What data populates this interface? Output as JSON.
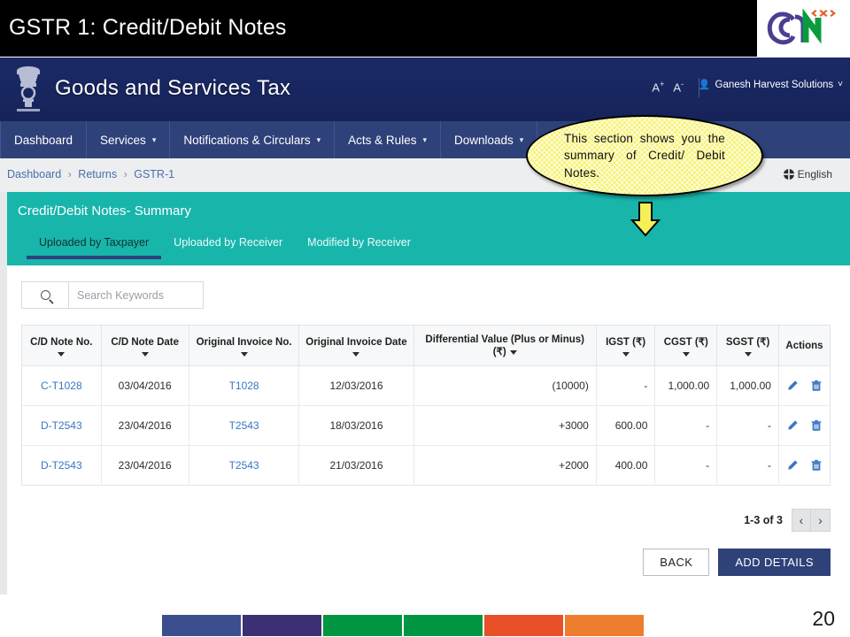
{
  "slide": {
    "title": "GSTR 1: Credit/Debit Notes",
    "number": "20",
    "logo_alt": "gstn-logo"
  },
  "portal_header": {
    "title": "Goods and Services Tax",
    "font_increase": "A",
    "font_increase_sup": "+",
    "font_decrease": "A",
    "font_decrease_sup": "-",
    "user_name": "Ganesh Harvest Solutions",
    "user_caret": "˅"
  },
  "nav": {
    "items": [
      {
        "label": "Dashboard",
        "has_caret": false
      },
      {
        "label": "Services",
        "has_caret": true
      },
      {
        "label": "Notifications & Circulars",
        "has_caret": true
      },
      {
        "label": "Acts & Rules",
        "has_caret": true
      },
      {
        "label": "Downloads",
        "has_caret": true
      }
    ],
    "caret": "▾"
  },
  "breadcrumb": {
    "items": [
      "Dashboard",
      "Returns",
      "GSTR-1"
    ],
    "separator": "›"
  },
  "language": {
    "label": "English"
  },
  "panel": {
    "title": "Credit/Debit Notes- Summary",
    "tabs": [
      {
        "label": "Uploaded by Taxpayer",
        "active": true
      },
      {
        "label": "Uploaded by Receiver",
        "active": false
      },
      {
        "label": "Modified by Receiver",
        "active": false
      }
    ]
  },
  "search": {
    "placeholder": "Search Keywords",
    "value": "",
    "icon": "search-icon"
  },
  "table": {
    "columns": [
      {
        "label": "C/D Note No.",
        "sortable": true
      },
      {
        "label": "C/D Note Date",
        "sortable": true
      },
      {
        "label": "Original Invoice No.",
        "sortable": true
      },
      {
        "label": "Original Invoice Date",
        "sortable": true
      },
      {
        "label": "Differential Value (Plus or Minus) (₹)",
        "sortable": true
      },
      {
        "label": "IGST (₹)",
        "sortable": true
      },
      {
        "label": "CGST (₹)",
        "sortable": true
      },
      {
        "label": "SGST (₹)",
        "sortable": true
      },
      {
        "label": "Actions",
        "sortable": false
      }
    ],
    "rows": [
      {
        "note_no": "C-T1028",
        "note_date": "03/04/2016",
        "invoice_no": "T1028",
        "invoice_date": "12/03/2016",
        "differential_value": "(10000)",
        "igst": "-",
        "cgst": "1,000.00",
        "sgst": "1,000.00"
      },
      {
        "note_no": "D-T2543",
        "note_date": "23/04/2016",
        "invoice_no": "T2543",
        "invoice_date": "18/03/2016",
        "differential_value": "+3000",
        "igst": "600.00",
        "cgst": "-",
        "sgst": "-"
      },
      {
        "note_no": "D-T2543",
        "note_date": "23/04/2016",
        "invoice_no": "T2543",
        "invoice_date": "21/03/2016",
        "differential_value": "+2000",
        "igst": "400.00",
        "cgst": "-",
        "sgst": "-"
      }
    ],
    "row_actions": {
      "edit": "edit-icon",
      "delete": "delete-icon"
    }
  },
  "pagination": {
    "label": "1-3 of 3",
    "prev": "‹",
    "next": "›"
  },
  "buttons": {
    "back": "BACK",
    "add_details": "ADD DETAILS"
  },
  "callout": {
    "text": "This section shows you the summary of Credit/ Debit Notes."
  },
  "footer_bars": [
    "#3b4f8e",
    "#3d2f73",
    "#009641",
    "#009641",
    "#e8502a",
    "#ee7e2d"
  ],
  "colors": {
    "title_bar": "#000000",
    "header_navy": "#17245e",
    "nav_blue": "#2e4179",
    "teal": "#18b5ab",
    "link_blue": "#3a76c4",
    "callout_yellow": "#f5f05a"
  }
}
